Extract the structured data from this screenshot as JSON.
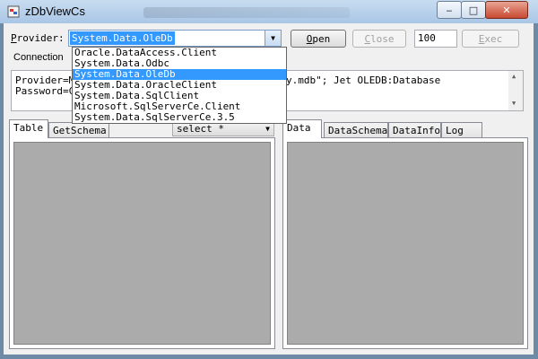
{
  "window": {
    "title": "zDbViewCs",
    "minimize": "‒",
    "maximize": "□",
    "close": "✕"
  },
  "provider": {
    "label_u": "P",
    "label_rest": "rovider:",
    "selected": "System.Data.OleDb",
    "options": [
      "Oracle.DataAccess.Client",
      "System.Data.Odbc",
      "System.Data.OleDb",
      "System.Data.OracleClient",
      "System.Data.SqlClient",
      "Microsoft.SqlServerCe.Client",
      "System.Data.SqlServerCe.3.5"
    ],
    "selected_index": 2
  },
  "buttons": {
    "open_u": "O",
    "open_rest": "pen",
    "close_u": "C",
    "close_rest": "lose",
    "exec_u": "E",
    "exec_rest": "xec"
  },
  "max_rows": "100",
  "connection": {
    "label": "Connection",
    "line1_start": "Provider=M",
    "line1_end": "y.mdb\"; Jet OLEDB:Database",
    "line2_start": "Password=C"
  },
  "left_tabs": [
    "Table",
    "GetSchema"
  ],
  "right_tabs": [
    "Data",
    "DataSchema",
    "DataInfo",
    "Log"
  ],
  "query_select": "select *",
  "colors": {
    "selection": "#3399ff",
    "grid_background": "#ababab"
  }
}
